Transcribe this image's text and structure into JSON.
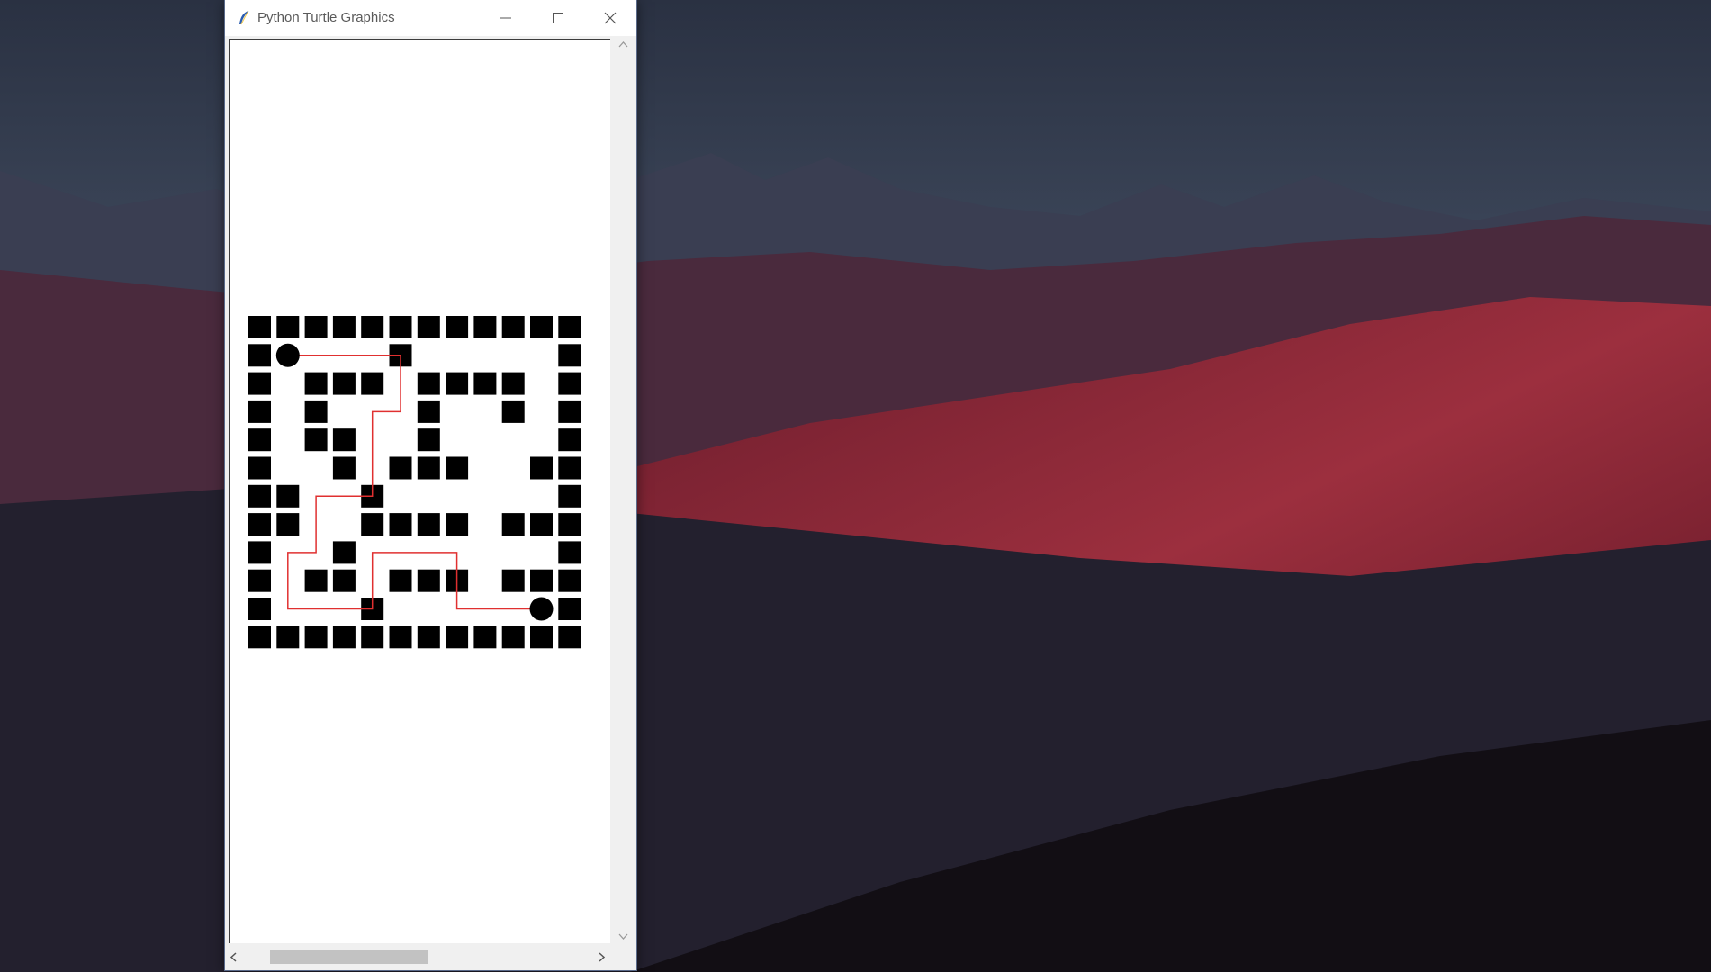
{
  "window": {
    "title": "Python Turtle Graphics",
    "controls": [
      "minimize-icon",
      "maximize-icon",
      "close-icon"
    ]
  },
  "maze": {
    "grid": [
      "############",
      "#S   #     #",
      "# ### #### #",
      "# #   #  # #",
      "# ##  #    #",
      "#  # ###  ##",
      "##  #      #",
      "##  #### ###",
      "#  #       #",
      "# ## ### ###",
      "#   #     E#",
      "############"
    ],
    "wall_color": "#000000",
    "path_color": "#e03030",
    "marker_color": "#000000",
    "path_cells": [
      [
        1,
        1
      ],
      [
        1,
        2
      ],
      [
        1,
        3
      ],
      [
        1,
        4
      ],
      [
        1,
        5
      ],
      [
        2,
        5
      ],
      [
        3,
        5
      ],
      [
        3,
        4
      ],
      [
        4,
        4
      ],
      [
        5,
        4
      ],
      [
        6,
        4
      ],
      [
        6,
        3
      ],
      [
        6,
        2
      ],
      [
        7,
        2
      ],
      [
        8,
        2
      ],
      [
        8,
        1
      ],
      [
        9,
        1
      ],
      [
        10,
        1
      ],
      [
        10,
        2
      ],
      [
        10,
        3
      ],
      [
        10,
        4
      ],
      [
        9,
        4
      ],
      [
        8,
        4
      ],
      [
        8,
        5
      ],
      [
        8,
        6
      ],
      [
        8,
        7
      ],
      [
        9,
        7
      ],
      [
        10,
        7
      ],
      [
        10,
        8
      ],
      [
        10,
        9
      ],
      [
        10,
        10
      ]
    ]
  },
  "colors": {
    "titlebar": "#ffffff",
    "window_bg": "#f0f0f0",
    "canvas_bg": "#ffffff"
  }
}
